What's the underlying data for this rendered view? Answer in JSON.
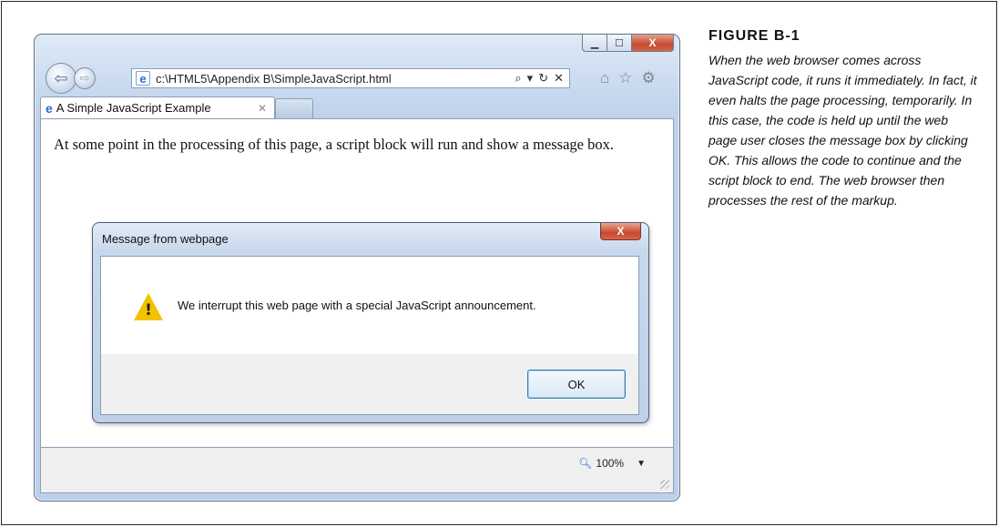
{
  "figure": {
    "label": "FIGURE B-1",
    "caption": "When the web browser comes across JavaScript code, it runs it immediately. In fact, it even halts the page processing, temporarily. In this case, the code is held up until the web page user closes the message box by clicking OK. This allows the code to continue and the script block to end. The web browser then processes the rest of the markup."
  },
  "browser": {
    "window_controls": {
      "minimize": "▁",
      "maximize": "☐",
      "close": "X"
    },
    "address": "c:\\HTML5\\Appendix B\\SimpleJavaScript.html",
    "address_tools": {
      "search": "⌕",
      "dropdown": "▾",
      "refresh": "↻",
      "stop": "✕"
    },
    "toolbar_icons": [
      "home-icon",
      "favorites-star-icon",
      "settings-gear-icon"
    ],
    "tab": {
      "title": "A Simple JavaScript Example",
      "close": "✕"
    },
    "page_text": "At some point in the processing of this page, a script block will run and show a message box.",
    "status": {
      "zoom": "100%"
    }
  },
  "dialog": {
    "title": "Message from webpage",
    "close": "X",
    "message": "We interrupt this web page with a special JavaScript announcement.",
    "ok_label": "OK"
  }
}
